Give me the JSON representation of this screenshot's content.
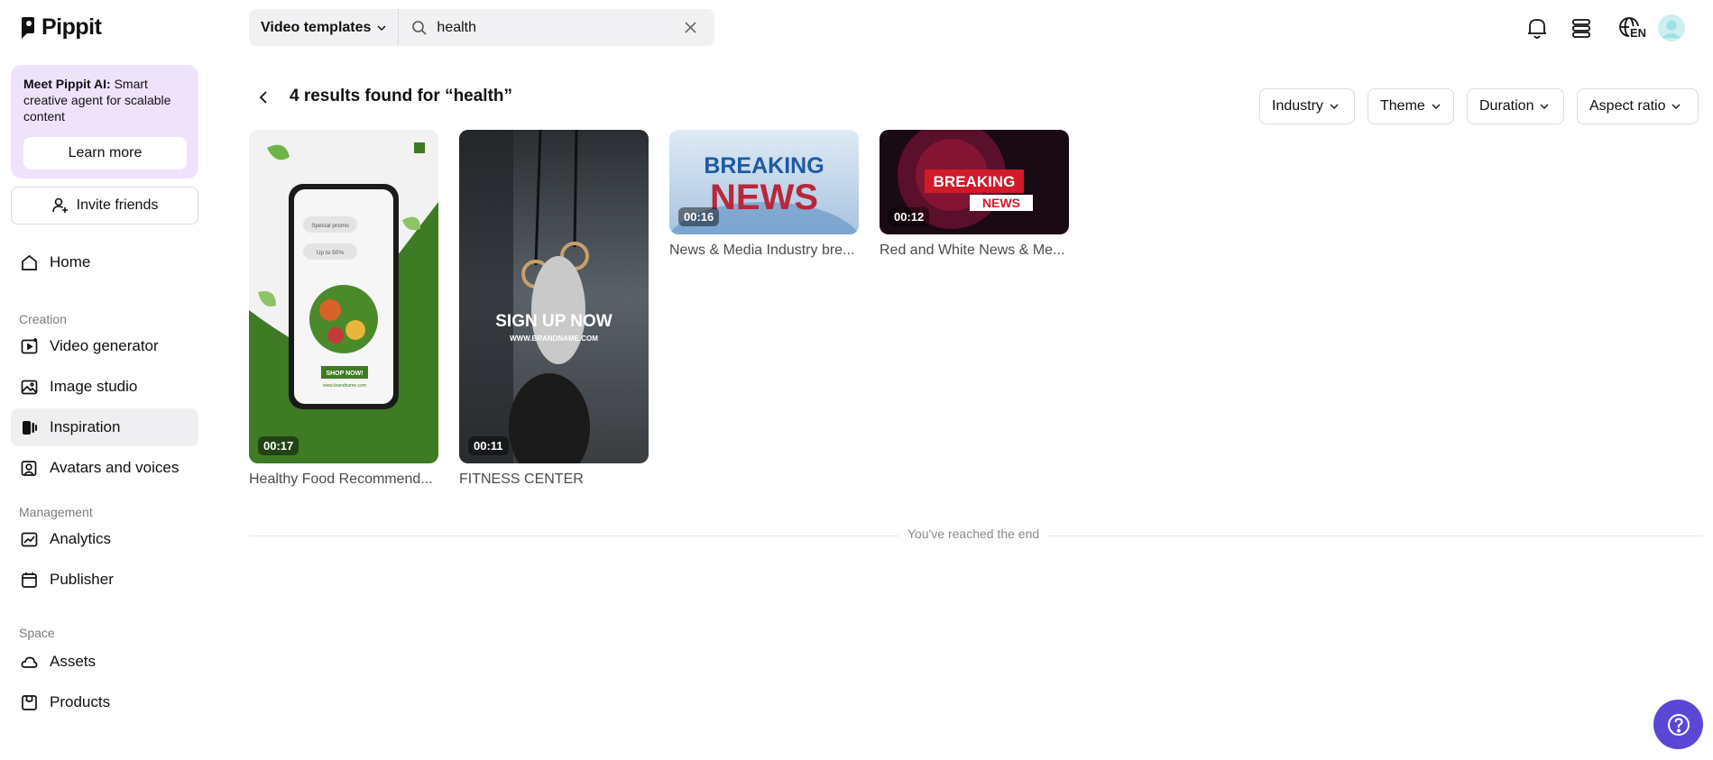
{
  "app": {
    "name": "Pippit"
  },
  "sidebar": {
    "promo": {
      "title": "Meet Pippit AI:",
      "text": "Smart creative agent for scalable content",
      "button": "Learn more"
    },
    "invite_label": "Invite friends",
    "home": "Home",
    "sections": {
      "creation": "Creation",
      "management": "Management",
      "space": "Space"
    },
    "creation_items": [
      "Video generator",
      "Image studio",
      "Inspiration",
      "Avatars and voices"
    ],
    "management_items": [
      "Analytics",
      "Publisher"
    ],
    "space_items": [
      "Assets",
      "Products"
    ],
    "active_item": "Inspiration"
  },
  "topbar": {
    "type_select": "Video templates",
    "search_value": "health",
    "language": "EN"
  },
  "results": {
    "title": "4 results found for “health”",
    "filters": [
      "Industry",
      "Theme",
      "Duration",
      "Aspect ratio"
    ],
    "cards": [
      {
        "title": "Healthy Food Recommend...",
        "duration": "00:17",
        "thumb": {
          "promo1": "Special promo",
          "promo2": "Up to 50%",
          "cta": "SHOP NOW!",
          "url": "www.brandname.com"
        }
      },
      {
        "title": "FITNESS CENTER",
        "duration": "00:11",
        "thumb": {
          "headline": "SIGN UP NOW",
          "url": "WWW.BRANDNAME.COM"
        }
      },
      {
        "title": "News & Media Industry bre...",
        "duration": "00:16",
        "thumb": {
          "line1": "BREAKING",
          "line2": "NEWS"
        }
      },
      {
        "title": "Red and White News & Me...",
        "duration": "00:12",
        "thumb": {
          "line1": "BREAKING",
          "line2": "NEWS"
        }
      }
    ],
    "end_text": "You've reached the end"
  },
  "colors": {
    "accent": "#5b47d6",
    "promo_bg": "#efe3fb",
    "active_nav": "#efeff1"
  }
}
